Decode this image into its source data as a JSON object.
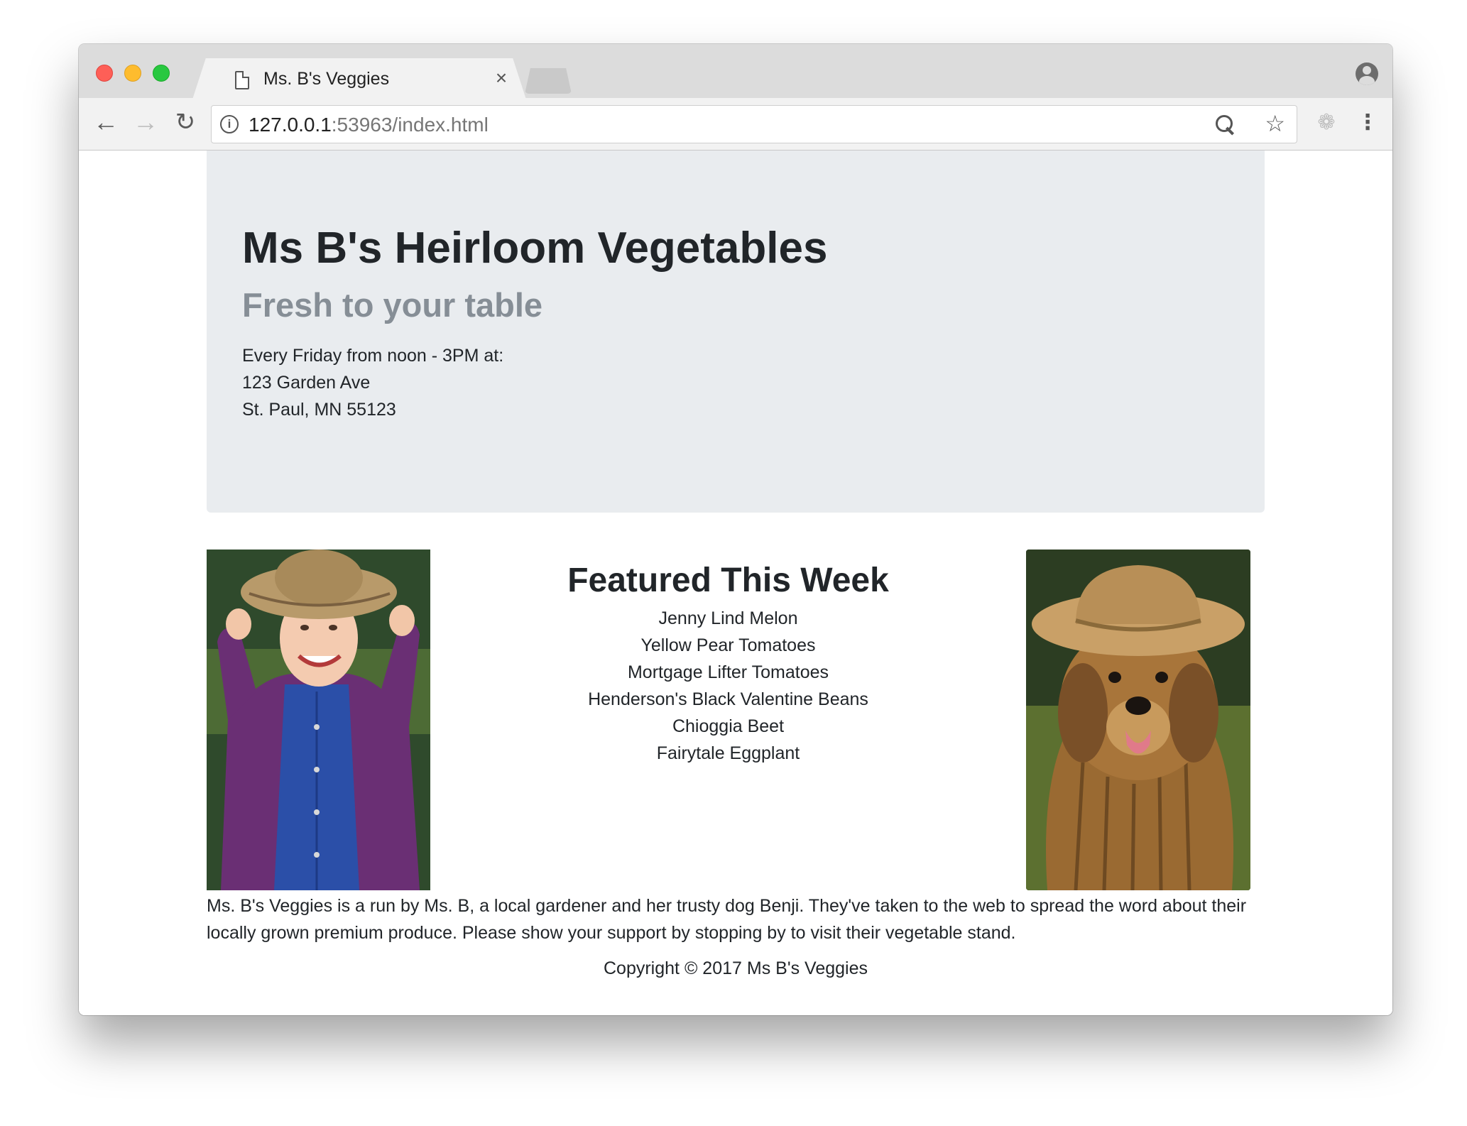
{
  "browser": {
    "tab_title": "Ms. B's Veggies",
    "tab_close": "×",
    "url_host": "127.0.0.1",
    "url_rest": ":53963/index.html",
    "icons": {
      "back": "←",
      "forward": "→",
      "reload": "↻",
      "info": "i",
      "star": "☆",
      "extension": "❁",
      "menu": "⋮"
    }
  },
  "page": {
    "jumbotron": {
      "title": "Ms B's Heirloom Vegetables",
      "subtitle": "Fresh to your table",
      "schedule": "Every Friday from noon - 3PM at:",
      "street": "123 Garden Ave",
      "city": "St. Paul, MN 55123"
    },
    "featured": {
      "title": "Featured This Week",
      "items": [
        "Jenny Lind Melon",
        "Yellow Pear Tomatoes",
        "Mortgage Lifter Tomatoes",
        "Henderson's Black Valentine Beans",
        "Chioggia Beet",
        "Fairytale Eggplant"
      ]
    },
    "about": "Ms. B's Veggies is a run by Ms. B, a local gardener and her trusty dog Benji. They've taken to the web to spread the word about their locally grown premium produce. Please show your support by stopping by to visit their vegetable stand.",
    "footer": "Copyright © 2017 Ms B's Veggies"
  }
}
